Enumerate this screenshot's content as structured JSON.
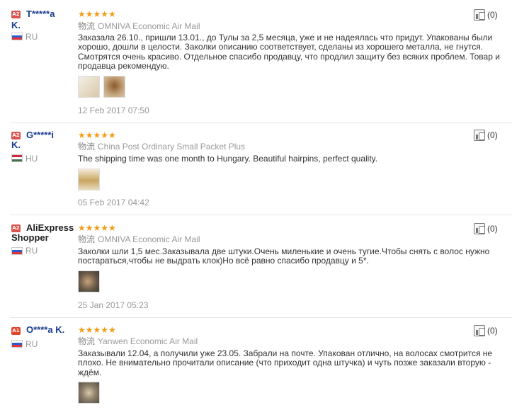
{
  "reviews": [
    {
      "level": "A2",
      "level_color": "#d9534f",
      "name_line1": "T*****a",
      "name_line2": "K.",
      "name_color": "#1a3c8f",
      "country": "RU",
      "flag": [
        "#ffffff",
        "#2f5cc7",
        "#d9363e"
      ],
      "stars": "★★★★★",
      "ship_prefix": "物流",
      "ship_method": "OMNIVA Economic Air Mail",
      "text": "Заказала 26.10., пришли 13.01., до Тулы за 2,5 месяца, уже и не надеялась что придут. Упакованы были хорошо, дошли в целости. Заколки описанию соответствует, сделаны из хорошего металла, не гнутся. Смотрятся очень красиво. Отдельное спасибо продавцу, что продлил защиту без всяких проблем. Товар и продавца рекомендую.",
      "photos": [
        "#d8c8a8",
        "#b88a5a"
      ],
      "date": "12 Feb 2017 07:50",
      "helpful": "(0)"
    },
    {
      "level": "A2",
      "level_color": "#d9534f",
      "name_line1": "G*****i",
      "name_line2": "K.",
      "name_color": "#1a3c8f",
      "country": "HU",
      "flag": [
        "#cd2a3e",
        "#ffffff",
        "#436f4d"
      ],
      "stars": "★★★★★",
      "ship_prefix": "物流",
      "ship_method": "China Post Ordinary Small Packet Plus",
      "text": "The shipping time was one month to Hungary. Beautiful hairpins, perfect quality.",
      "photos": [
        "#c9a560"
      ],
      "date": "05 Feb 2017 04:42",
      "helpful": "(0)"
    },
    {
      "level": "A2",
      "level_color": "#d9534f",
      "name_line1": "AliExpress",
      "name_line2": "Shopper",
      "name_color": "#222222",
      "country": "RU",
      "flag": [
        "#ffffff",
        "#2f5cc7",
        "#d9363e"
      ],
      "stars": "★★★★★",
      "ship_prefix": "物流",
      "ship_method": "OMNIVA Economic Air Mail",
      "text": "Заколки шли 1,5 мес.Заказывала две штуки.Очень миленькие и очень тугие.Чтобы снять с волос нужно постараться,чтобы не выдрать клок)Но всё равно спасибо продавцу и 5*.",
      "photos": [
        "#7a6a5a"
      ],
      "date": "25 Jan 2017 05:23",
      "helpful": "(0)"
    },
    {
      "level": "A1",
      "level_color": "#e0442c",
      "name_line1": "O****a K.",
      "name_line2": "",
      "name_color": "#1a3c8f",
      "country": "RU",
      "flag": [
        "#ffffff",
        "#2f5cc7",
        "#d9363e"
      ],
      "stars": "★★★★★",
      "ship_prefix": "物流",
      "ship_method": "Yanwen Economic Air Mail",
      "text": "Заказывали 12.04, а получили уже 23.05. Забрали на почте. Упакован отлично, на волосах смотрится не плохо. Не внимательно прочитали описание (что приходит одна штучка) и чуть позже заказали вторую - ждём.",
      "photos": [
        "#8a7d68"
      ],
      "date": "",
      "helpful": "(0)"
    }
  ]
}
